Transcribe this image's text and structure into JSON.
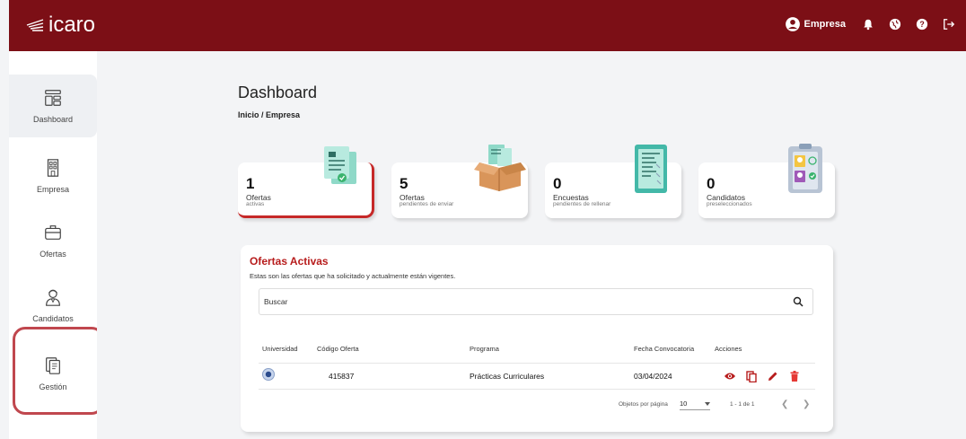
{
  "header": {
    "logo_text": "icaro",
    "user_label": "Empresa",
    "brand_color": "#7c0f16",
    "icons": [
      "user-circle-icon",
      "bell-icon",
      "globe-icon",
      "help-icon",
      "logout-icon"
    ]
  },
  "sidebar": {
    "items": [
      {
        "label": "Dashboard",
        "icon": "dashboard-icon"
      },
      {
        "label": "Empresa",
        "icon": "building-icon"
      },
      {
        "label": "Ofertas",
        "icon": "briefcase-icon"
      },
      {
        "label": "Candidatos",
        "icon": "person-icon"
      },
      {
        "label": "Gestión",
        "icon": "documents-icon"
      }
    ]
  },
  "page": {
    "title": "Dashboard",
    "breadcrumb": "Inicio / Empresa"
  },
  "stats": [
    {
      "value": "1",
      "label": "Ofertas",
      "sub": "activas"
    },
    {
      "value": "5",
      "label": "Ofertas",
      "sub": "pendientes de enviar"
    },
    {
      "value": "0",
      "label": "Encuestas",
      "sub": "pendientes de rellenar"
    },
    {
      "value": "0",
      "label": "Candidatos",
      "sub": "preseleccionados"
    }
  ],
  "offers": {
    "title": "Ofertas Activas",
    "description": "Estas son las ofertas que ha solicitado y actualmente están vigentes.",
    "search_placeholder": "Buscar",
    "columns": [
      "Universidad",
      "Código Oferta",
      "Programa",
      "Fecha Convocatoria",
      "Acciones"
    ],
    "rows": [
      {
        "codigo": "415837",
        "programa": "Prácticas Curriculares",
        "fecha": "03/04/2024"
      }
    ],
    "pagination": {
      "per_page_label": "Objetos por página",
      "per_page_value": "10",
      "range": "1 - 1 de 1"
    }
  },
  "colors": {
    "accent_red": "#c62828",
    "title_red": "#b71c1c",
    "highlight": "#c0474e"
  }
}
